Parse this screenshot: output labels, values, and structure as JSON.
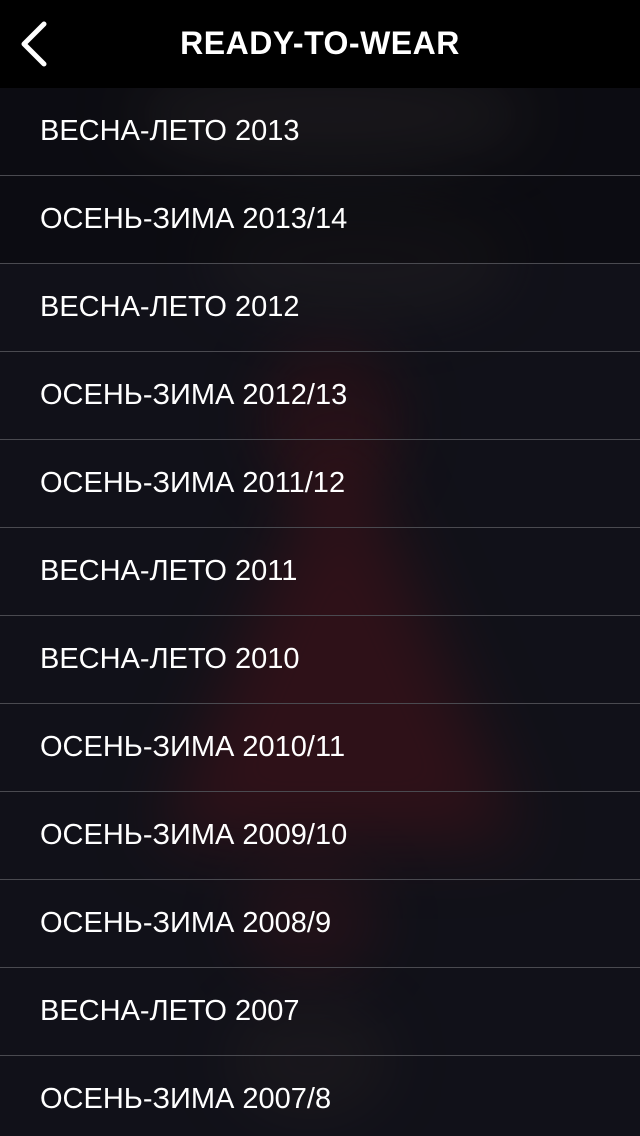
{
  "header": {
    "title": "READY-TO-WEAR",
    "back_icon": "chevron-left-icon"
  },
  "collections": [
    {
      "label": "ВЕСНА-ЛЕТО 2013"
    },
    {
      "label": "ОСЕНЬ-ЗИМА 2013/14"
    },
    {
      "label": "ВЕСНА-ЛЕТО 2012"
    },
    {
      "label": "ОСЕНЬ-ЗИМА 2012/13"
    },
    {
      "label": "ОСЕНЬ-ЗИМА 2011/12"
    },
    {
      "label": "ВЕСНА-ЛЕТО 2011"
    },
    {
      "label": "ВЕСНА-ЛЕТО 2010"
    },
    {
      "label": "ОСЕНЬ-ЗИМА 2010/11"
    },
    {
      "label": "ОСЕНЬ-ЗИМА 2009/10"
    },
    {
      "label": "ОСЕНЬ-ЗИМА 2008/9"
    },
    {
      "label": "ВЕСНА-ЛЕТО 2007"
    },
    {
      "label": "ОСЕНЬ-ЗИМА 2007/8"
    }
  ],
  "colors": {
    "header_background": "#000000",
    "list_background": "#15151d",
    "divider": "#4a4a50",
    "text": "#ffffff",
    "background_accent": "#8c161c"
  }
}
